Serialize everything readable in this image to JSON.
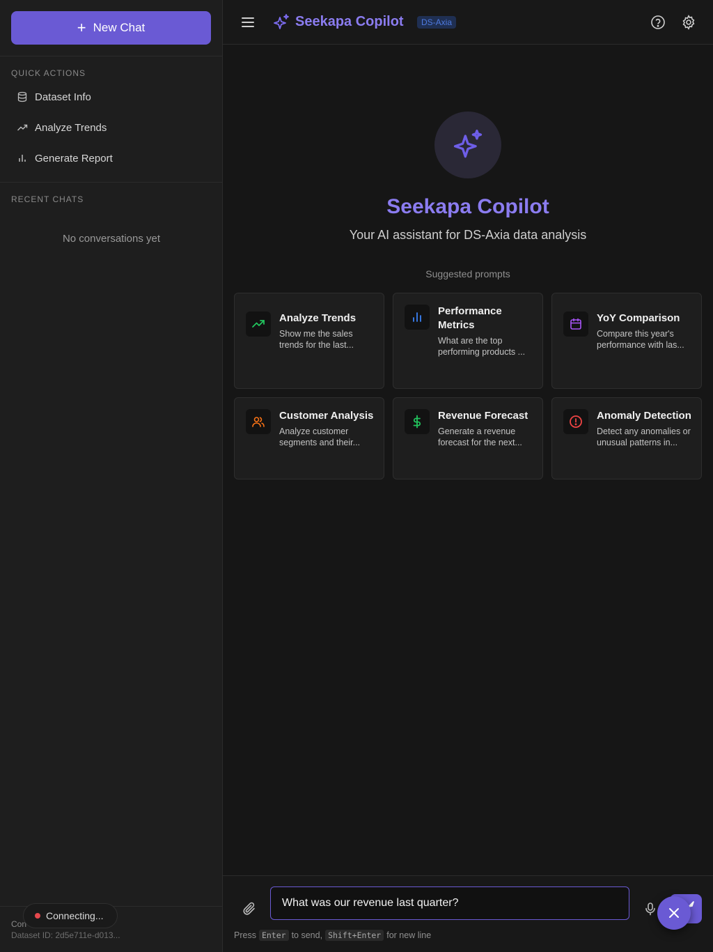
{
  "sidebar": {
    "new_chat_label": "New Chat",
    "quick_actions_title": "QUICK ACTIONS",
    "quick_actions": [
      {
        "label": "Dataset Info",
        "icon": "database-icon"
      },
      {
        "label": "Analyze Trends",
        "icon": "trend-icon"
      },
      {
        "label": "Generate Report",
        "icon": "bar-chart-icon"
      }
    ],
    "recent_chats_title": "RECENT CHATS",
    "empty_text": "No conversations yet",
    "footer_line1": "Con",
    "footer_line2": "Dataset ID: 2d5e711e-d013...",
    "connection_status": "Connecting..."
  },
  "header": {
    "title": "Seekapa Copilot",
    "badge": "DS-Axia"
  },
  "hero": {
    "title": "Seekapa Copilot",
    "subtitle": "Your AI assistant for DS-Axia data analysis",
    "suggested_label": "Suggested prompts"
  },
  "cards": [
    {
      "title": "Analyze Trends",
      "desc": "Show me the sales trends for the last...",
      "icon": "trend-up-icon",
      "color": "#22c55e"
    },
    {
      "title": "Performance Metrics",
      "desc": "What are the top performing products ...",
      "icon": "bar-chart-icon",
      "color": "#3b82f6"
    },
    {
      "title": "YoY Comparison",
      "desc": "Compare this year's performance with las...",
      "icon": "calendar-icon",
      "color": "#a855f7"
    },
    {
      "title": "Customer Analysis",
      "desc": "Analyze customer segments and their...",
      "icon": "users-icon",
      "color": "#f97316"
    },
    {
      "title": "Revenue Forecast",
      "desc": "Generate a revenue forecast for the next...",
      "icon": "dollar-icon",
      "color": "#22c55e"
    },
    {
      "title": "Anomaly Detection",
      "desc": "Detect any anomalies or unusual patterns in...",
      "icon": "alert-circle-icon",
      "color": "#ef4444"
    }
  ],
  "input": {
    "value": "What was our revenue last quarter?",
    "hint_press": "Press",
    "hint_enter": "Enter",
    "hint_to_send": "to send,",
    "hint_shift_enter": "Shift+Enter",
    "hint_new_line": "for new line"
  },
  "colors": {
    "accent": "#6a5ad4",
    "title": "#8b7cf0",
    "status_dot": "#e5484d"
  }
}
